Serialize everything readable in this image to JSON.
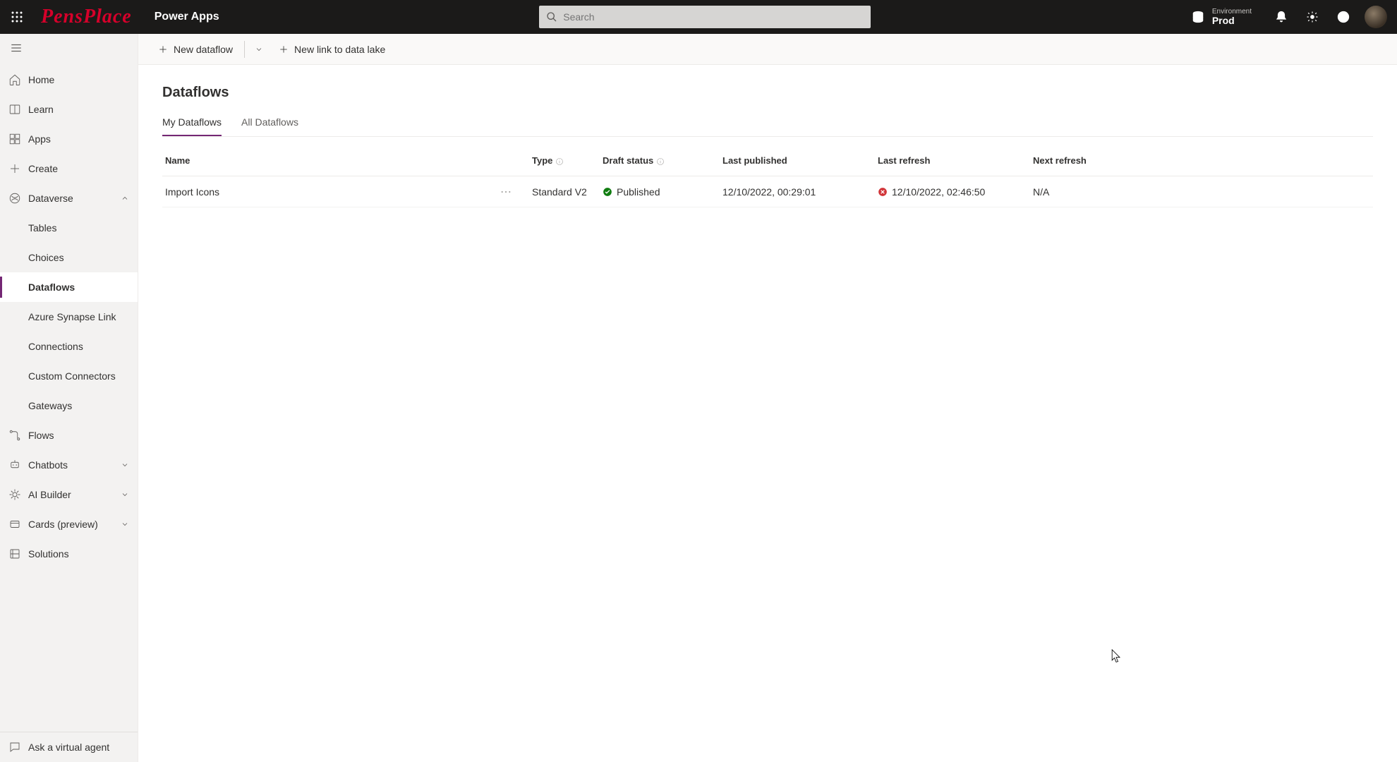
{
  "header": {
    "logo_text": "PensPlace",
    "app_name": "Power Apps",
    "search_placeholder": "Search",
    "env_label": "Environment",
    "env_name": "Prod"
  },
  "sidebar": {
    "items": [
      {
        "id": "home",
        "label": "Home"
      },
      {
        "id": "learn",
        "label": "Learn"
      },
      {
        "id": "apps",
        "label": "Apps"
      },
      {
        "id": "create",
        "label": "Create"
      },
      {
        "id": "dataverse",
        "label": "Dataverse",
        "expandable": true,
        "expanded": true
      },
      {
        "id": "flows",
        "label": "Flows"
      },
      {
        "id": "chatbots",
        "label": "Chatbots",
        "expandable": true
      },
      {
        "id": "aibuilder",
        "label": "AI Builder",
        "expandable": true
      },
      {
        "id": "cards",
        "label": "Cards (preview)",
        "expandable": true
      },
      {
        "id": "solutions",
        "label": "Solutions"
      }
    ],
    "dataverse_children": [
      {
        "id": "tables",
        "label": "Tables"
      },
      {
        "id": "choices",
        "label": "Choices"
      },
      {
        "id": "dataflows",
        "label": "Dataflows",
        "active": true
      },
      {
        "id": "synapse",
        "label": "Azure Synapse Link"
      },
      {
        "id": "connections",
        "label": "Connections"
      },
      {
        "id": "customconn",
        "label": "Custom Connectors"
      },
      {
        "id": "gateways",
        "label": "Gateways"
      }
    ],
    "footer": {
      "label": "Ask a virtual agent"
    }
  },
  "commandbar": {
    "new_dataflow": "New dataflow",
    "new_link": "New link to data lake"
  },
  "page": {
    "title": "Dataflows",
    "tabs": [
      {
        "id": "my",
        "label": "My Dataflows",
        "active": true
      },
      {
        "id": "all",
        "label": "All Dataflows"
      }
    ],
    "columns": {
      "name": "Name",
      "type": "Type",
      "draft_status": "Draft status",
      "last_published": "Last published",
      "last_refresh": "Last refresh",
      "next_refresh": "Next refresh"
    },
    "rows": [
      {
        "name": "Import Icons",
        "type": "Standard V2",
        "draft_status": "Published",
        "draft_status_state": "ok",
        "last_published": "12/10/2022, 00:29:01",
        "last_refresh": "12/10/2022, 02:46:50",
        "last_refresh_state": "error",
        "next_refresh": "N/A"
      }
    ]
  },
  "colors": {
    "accent": "#742774",
    "error": "#d13438",
    "ok": "#107c10"
  }
}
